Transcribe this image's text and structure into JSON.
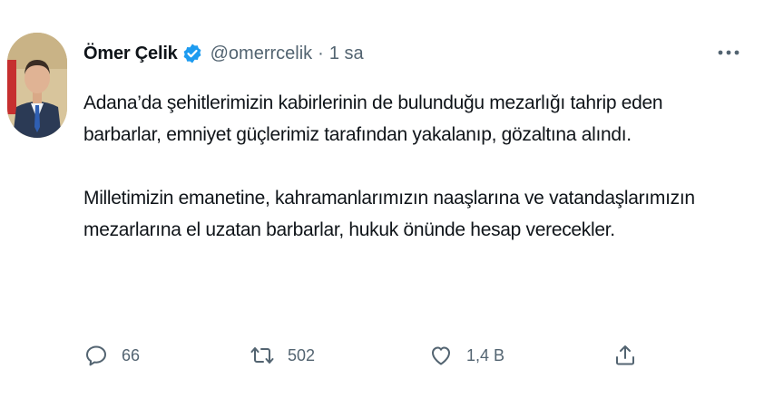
{
  "tweet": {
    "author": {
      "name": "Ömer Çelik",
      "handle": "@omerrcelik",
      "verified": true,
      "avatar": "profile-photo"
    },
    "separator": "·",
    "time": "1 sa",
    "paragraphs": [
      "Adana’da şehitlerimizin kabirlerinin de bulunduğu mezarlığı tahrip eden barbarlar, emniyet güçlerimiz tarafından yakalanıp, gözaltına alındı.",
      "Milletimizin emanetine, kahramanlarımızın naaşlarına ve vatandaşlarımızın mezarlarına el uzatan barbarlar, hukuk önünde hesap verecekler."
    ],
    "actions": {
      "reply": {
        "icon": "reply-icon",
        "count": "66"
      },
      "retweet": {
        "icon": "retweet-icon",
        "count": "502"
      },
      "like": {
        "icon": "heart-icon",
        "count": "1,4 B"
      },
      "share": {
        "icon": "share-icon"
      }
    },
    "more_icon": "more-icon"
  },
  "colors": {
    "verified": "#1d9bf0",
    "secondary_text": "#536471",
    "primary_text": "#0f1419",
    "background": "#ffffff"
  }
}
